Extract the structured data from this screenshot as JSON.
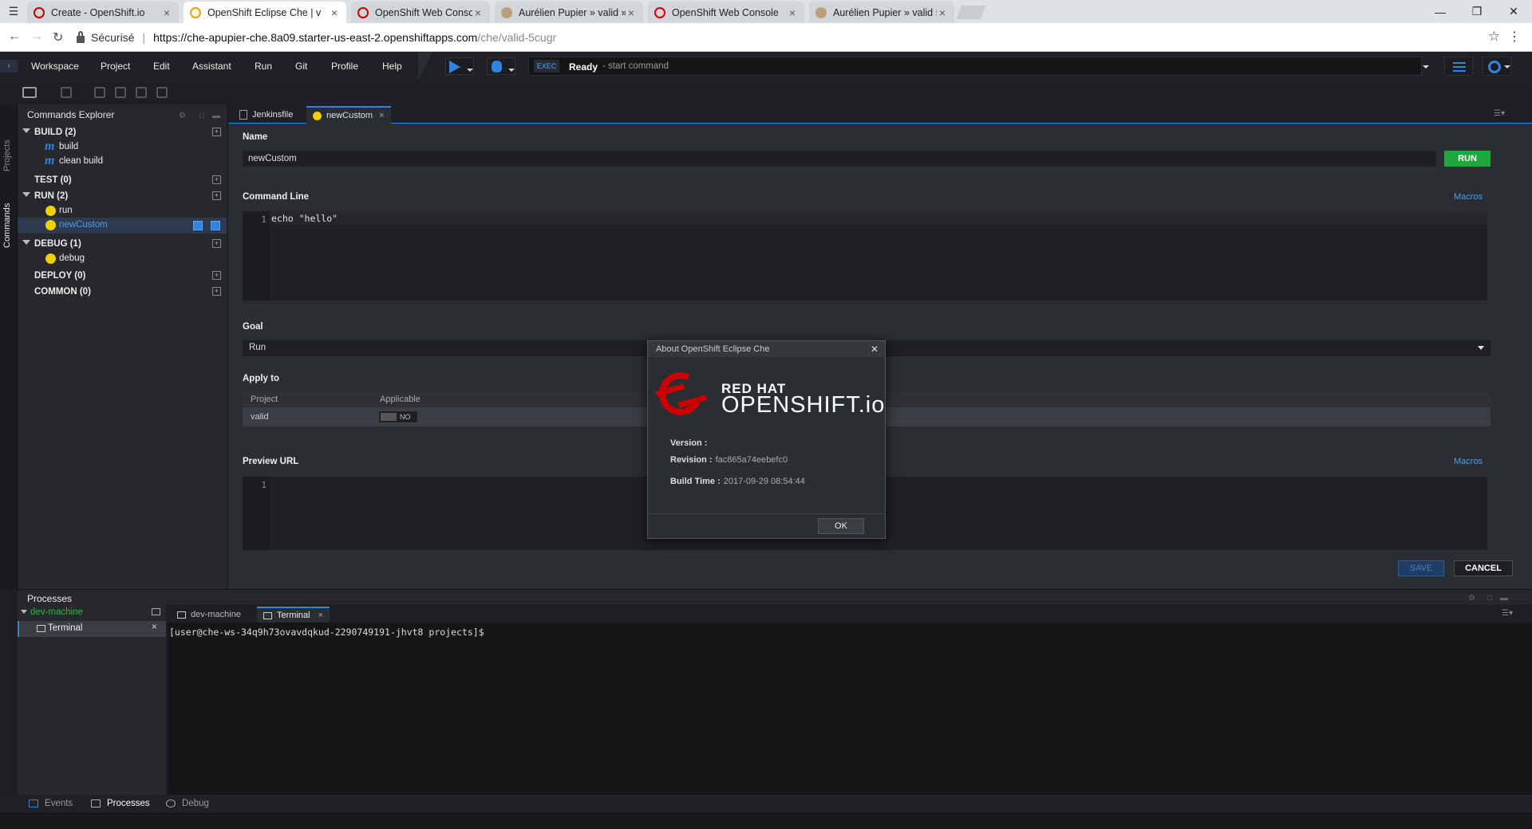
{
  "browser": {
    "tabs": [
      {
        "title": "Create - OpenShift.io"
      },
      {
        "title": "OpenShift Eclipse Che | v"
      },
      {
        "title": "OpenShift Web Console"
      },
      {
        "title": "Aurélien Pupier » valid »"
      },
      {
        "title": "OpenShift Web Console"
      },
      {
        "title": "Aurélien Pupier » valid »"
      }
    ],
    "secure_label": "Sécurisé",
    "url_host": "https://che-apupier-che.8a09.starter-us-east-2.openshiftapps.com",
    "url_path": "/che/valid-5cugr"
  },
  "menu": {
    "items": [
      "Workspace",
      "Project",
      "Edit",
      "Assistant",
      "Run",
      "Git",
      "Profile",
      "Help"
    ],
    "exec_badge": "EXEC",
    "status": "Ready",
    "status_hint": "- start command"
  },
  "sidebar": {
    "tabs": [
      "Projects",
      "Commands"
    ]
  },
  "commands_explorer": {
    "title": "Commands Explorer",
    "groups": [
      {
        "label": "BUILD (2)",
        "items": [
          "build",
          "clean build"
        ]
      },
      {
        "label": "TEST (0)",
        "items": []
      },
      {
        "label": "RUN (2)",
        "items": [
          "run",
          "newCustom"
        ]
      },
      {
        "label": "DEBUG (1)",
        "items": [
          "debug"
        ]
      },
      {
        "label": "DEPLOY (0)",
        "items": []
      },
      {
        "label": "COMMON (0)",
        "items": []
      }
    ]
  },
  "editor": {
    "tabs": [
      "Jenkinsfile",
      "newCustom"
    ],
    "name_label": "Name",
    "name_value": "newCustom",
    "run_label": "RUN",
    "command_line_label": "Command Line",
    "macros_label": "Macros",
    "command_line_number": "1",
    "command_line_code": "echo \"hello\"",
    "goal_label": "Goal",
    "goal_value": "Run",
    "apply_to_label": "Apply to",
    "apply_to_columns": [
      "Project",
      "Applicable"
    ],
    "apply_to_rows": [
      {
        "project": "valid",
        "applicable": "NO"
      }
    ],
    "preview_url_label": "Preview URL",
    "preview_line_number": "1",
    "save_label": "SAVE",
    "cancel_label": "CANCEL"
  },
  "processes": {
    "title": "Processes",
    "machine": "dev-machine",
    "terminal_node": "Terminal",
    "tabs": [
      "dev-machine",
      "Terminal"
    ],
    "terminal_prompt": "[user@che-ws-34q9h73ovavdqkud-2290749191-jhvt8 projects]$"
  },
  "bottom_tabs": [
    "Events",
    "Processes",
    "Debug"
  ],
  "about_dialog": {
    "title": "About OpenShift Eclipse Che",
    "logo_line1": "RED HAT",
    "logo_line2": "OPENSHIFT.io",
    "version_label": "Version :",
    "version_value": "",
    "revision_label": "Revision :",
    "revision_value": "fac865a74eebefc0",
    "build_time_label": "Build Time :",
    "build_time_value": "2017-09-29 08:54:44",
    "ok_label": "OK"
  },
  "colors": {
    "accent": "#2e84e0",
    "run_green": "#1ea73b",
    "redhat_red": "#cc0000"
  }
}
